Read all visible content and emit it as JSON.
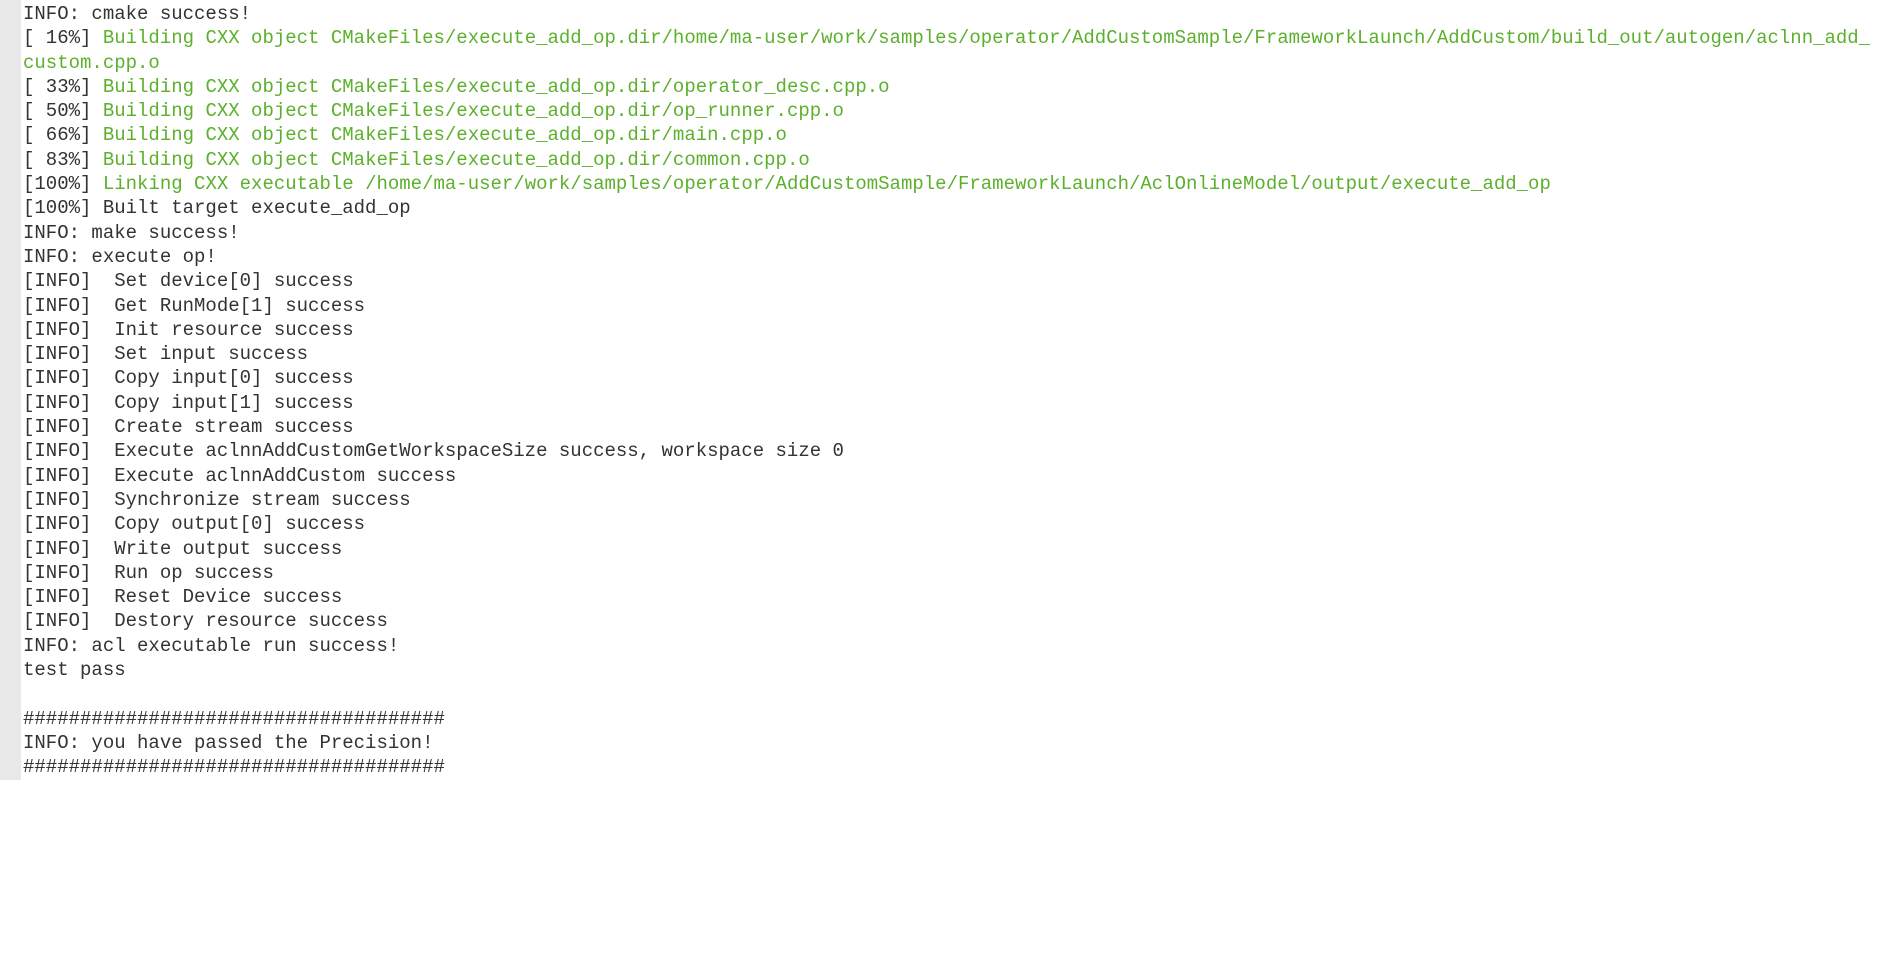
{
  "lines": [
    {
      "segments": [
        {
          "text": "INFO: cmake success!",
          "color": "black"
        }
      ]
    },
    {
      "segments": [
        {
          "text": "[ 16%] ",
          "color": "black"
        },
        {
          "text": "Building CXX object CMakeFiles/execute_add_op.dir/home/ma-user/work/samples/operator/AddCustomSample/FrameworkLaunch/AddCustom/build_out/autogen/aclnn_add_custom.cpp.o",
          "color": "green"
        }
      ]
    },
    {
      "segments": [
        {
          "text": "[ 33%] ",
          "color": "black"
        },
        {
          "text": "Building CXX object CMakeFiles/execute_add_op.dir/operator_desc.cpp.o",
          "color": "green"
        }
      ]
    },
    {
      "segments": [
        {
          "text": "[ 50%] ",
          "color": "black"
        },
        {
          "text": "Building CXX object CMakeFiles/execute_add_op.dir/op_runner.cpp.o",
          "color": "green"
        }
      ]
    },
    {
      "segments": [
        {
          "text": "[ 66%] ",
          "color": "black"
        },
        {
          "text": "Building CXX object CMakeFiles/execute_add_op.dir/main.cpp.o",
          "color": "green"
        }
      ]
    },
    {
      "segments": [
        {
          "text": "[ 83%] ",
          "color": "black"
        },
        {
          "text": "Building CXX object CMakeFiles/execute_add_op.dir/common.cpp.o",
          "color": "green"
        }
      ]
    },
    {
      "segments": [
        {
          "text": "[100%] ",
          "color": "black"
        },
        {
          "text": "Linking CXX executable /home/ma-user/work/samples/operator/AddCustomSample/FrameworkLaunch/AclOnlineModel/output/execute_add_op",
          "color": "green"
        }
      ]
    },
    {
      "segments": [
        {
          "text": "[100%] Built target execute_add_op",
          "color": "black"
        }
      ]
    },
    {
      "segments": [
        {
          "text": "INFO: make success!",
          "color": "black"
        }
      ]
    },
    {
      "segments": [
        {
          "text": "INFO: execute op!",
          "color": "black"
        }
      ]
    },
    {
      "segments": [
        {
          "text": "[INFO]  Set device[0] success",
          "color": "black"
        }
      ]
    },
    {
      "segments": [
        {
          "text": "[INFO]  Get RunMode[1] success",
          "color": "black"
        }
      ]
    },
    {
      "segments": [
        {
          "text": "[INFO]  Init resource success",
          "color": "black"
        }
      ]
    },
    {
      "segments": [
        {
          "text": "[INFO]  Set input success",
          "color": "black"
        }
      ]
    },
    {
      "segments": [
        {
          "text": "[INFO]  Copy input[0] success",
          "color": "black"
        }
      ]
    },
    {
      "segments": [
        {
          "text": "[INFO]  Copy input[1] success",
          "color": "black"
        }
      ]
    },
    {
      "segments": [
        {
          "text": "[INFO]  Create stream success",
          "color": "black"
        }
      ]
    },
    {
      "segments": [
        {
          "text": "[INFO]  Execute aclnnAddCustomGetWorkspaceSize success, workspace size 0",
          "color": "black"
        }
      ]
    },
    {
      "segments": [
        {
          "text": "[INFO]  Execute aclnnAddCustom success",
          "color": "black"
        }
      ]
    },
    {
      "segments": [
        {
          "text": "[INFO]  Synchronize stream success",
          "color": "black"
        }
      ]
    },
    {
      "segments": [
        {
          "text": "[INFO]  Copy output[0] success",
          "color": "black"
        }
      ]
    },
    {
      "segments": [
        {
          "text": "[INFO]  Write output success",
          "color": "black"
        }
      ]
    },
    {
      "segments": [
        {
          "text": "[INFO]  Run op success",
          "color": "black"
        }
      ]
    },
    {
      "segments": [
        {
          "text": "[INFO]  Reset Device success",
          "color": "black"
        }
      ]
    },
    {
      "segments": [
        {
          "text": "[INFO]  Destory resource success",
          "color": "black"
        }
      ]
    },
    {
      "segments": [
        {
          "text": "INFO: acl executable run success!",
          "color": "black"
        }
      ]
    },
    {
      "segments": [
        {
          "text": "test pass",
          "color": "black"
        }
      ]
    },
    {
      "segments": [
        {
          "text": " ",
          "color": "black"
        }
      ]
    },
    {
      "segments": [
        {
          "text": "#####################################",
          "color": "black"
        }
      ]
    },
    {
      "segments": [
        {
          "text": "INFO: you have passed the Precision!",
          "color": "black"
        }
      ]
    },
    {
      "segments": [
        {
          "text": "#####################################",
          "color": "black"
        }
      ]
    }
  ]
}
